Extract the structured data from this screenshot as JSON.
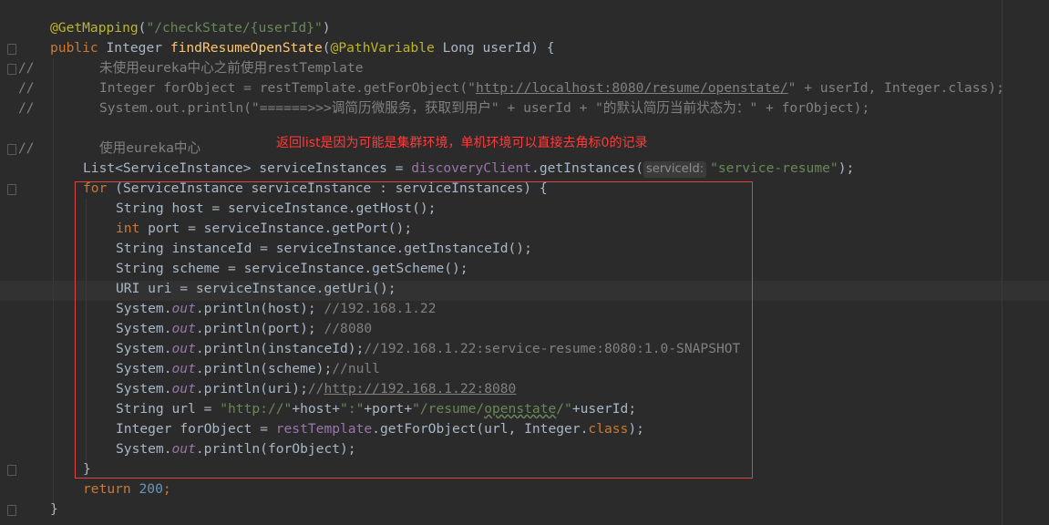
{
  "annotation": "返回list是因为可能是集群环境，单机环境可以直接去角标0的记录",
  "code": {
    "l1_mapping": "@GetMapping",
    "l1_paren_open": "(",
    "l1_path": "\"/checkState/{userId}\"",
    "l1_paren_close": ")",
    "l2_public": "public ",
    "l2_type": "Integer ",
    "l2_method": "findResumeOpenState",
    "l2_open": "(",
    "l2_anno": "@PathVariable",
    "l2_param": " Long userId) {",
    "l3_slash": "//",
    "l3_comment": "未使用eureka中心之前使用restTemplate",
    "l4_slash": "//",
    "l4_a": "Integer forObject = restTemplate.getForObject(\"",
    "l4_url": "http://localhost:8080/resume/openstate/",
    "l4_b": "\" + userId, Integer.class);",
    "l5_slash": "//",
    "l5_comment": "System.out.println(\"======>>>调简历微服务，获取到用户\" + userId + \"的默认简历当前状态为：\" + forObject);",
    "l6_slash": "//",
    "l6_comment": "使用eureka中心",
    "l7_a": "List<ServiceInstance> serviceInstances = ",
    "l7_field": "discoveryClient",
    "l7_b": ".getInstances(",
    "l7_hint": "serviceId:",
    "l7_str": "\"service-resume\"",
    "l7_c": ");",
    "l8_for": "for ",
    "l8_rest": "(ServiceInstance serviceInstance : serviceInstances) {",
    "l9": "String host = serviceInstance.getHost();",
    "l10_int": "int ",
    "l10_rest": "port = serviceInstance.getPort();",
    "l11": "String instanceId = serviceInstance.getInstanceId();",
    "l12": "String scheme = serviceInstance.getScheme();",
    "l13": "URI uri = serviceInstance.getUri();",
    "sys": "System.",
    "out": "out",
    "l14_a": ".println(host); ",
    "l14_c": "//192.168.1.22",
    "l15_a": ".println(port); ",
    "l15_c": "//8080",
    "l16_a": ".println(instanceId);",
    "l16_c": "//192.168.1.22:service-resume:8080:1.0-SNAPSHOT",
    "l17_a": ".println(scheme);",
    "l17_c": "//null",
    "l18_a": ".println(uri);",
    "l18_c1": "//",
    "l18_link": "http://192.168.1.22:8080",
    "l19_a": "String url = ",
    "l19_s1": "\"http://\"",
    "l19_b": "+host+",
    "l19_s2": "\":\"",
    "l19_c": "+port+",
    "l19_s3a": "\"/resume/",
    "l19_s3b": "openstate",
    "l19_s3c": "/\"",
    "l19_d": "+userId;",
    "l20_a": "Integer forObject = ",
    "l20_field": "restTemplate",
    "l20_b": ".getForObject(url, Integer.",
    "l20_class": "class",
    "l20_c": ");",
    "l21_a": ".println(forObject);",
    "l22": "}",
    "l23_kw": "return ",
    "l23_num": "200",
    "l23_end": ";",
    "l24": "}"
  }
}
